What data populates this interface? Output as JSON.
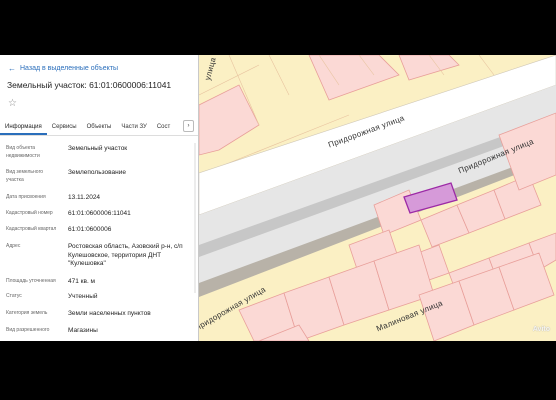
{
  "panel": {
    "back_link": "Назад в выделенные объекты",
    "title": "Земельный участок: 61:01:0600006:11041",
    "star_icon": "☆",
    "tabs": [
      "Информация",
      "Сервисы",
      "Объекты",
      "Части ЗУ",
      "Сост"
    ],
    "tab_next": "›",
    "fields": [
      {
        "label": "Вид объекта недвижимости",
        "value": "Земельный участок"
      },
      {
        "label": "Вид земельного участка",
        "value": "Землепользование"
      },
      {
        "label": "Дата присвоения",
        "value": "13.11.2024"
      },
      {
        "label": "Кадастровый номер",
        "value": "61:01:0600006:11041"
      },
      {
        "label": "Кадастровый квартал",
        "value": "61:01:0600006"
      },
      {
        "label": "Адрес",
        "value": "Ростовская область, Азовский р-н, с/п Кулешовское, территория ДНТ \"Кулешовка\""
      },
      {
        "label": "Площадь уточненная",
        "value": "471 кв. м"
      },
      {
        "label": "Статус",
        "value": "Учтенный"
      },
      {
        "label": "Категория земель",
        "value": "Земли населенных пунктов"
      },
      {
        "label": "Вид разрешенного",
        "value": "Магазины"
      }
    ]
  },
  "map": {
    "streets": [
      "Придорожная улица",
      "Придорожная улица",
      "Придорожная улица",
      "Малиновая улица",
      "улица"
    ],
    "watermark": "Avito",
    "colors": {
      "background": "#fbf0c4",
      "parcel_fill": "#fbd9d5",
      "parcel_stroke": "#e89f9a",
      "road": "#e8e8e8",
      "road_dark": "#b8b2a8",
      "selected_fill": "#d69ad9",
      "selected_stroke": "#9c2aa6"
    }
  }
}
